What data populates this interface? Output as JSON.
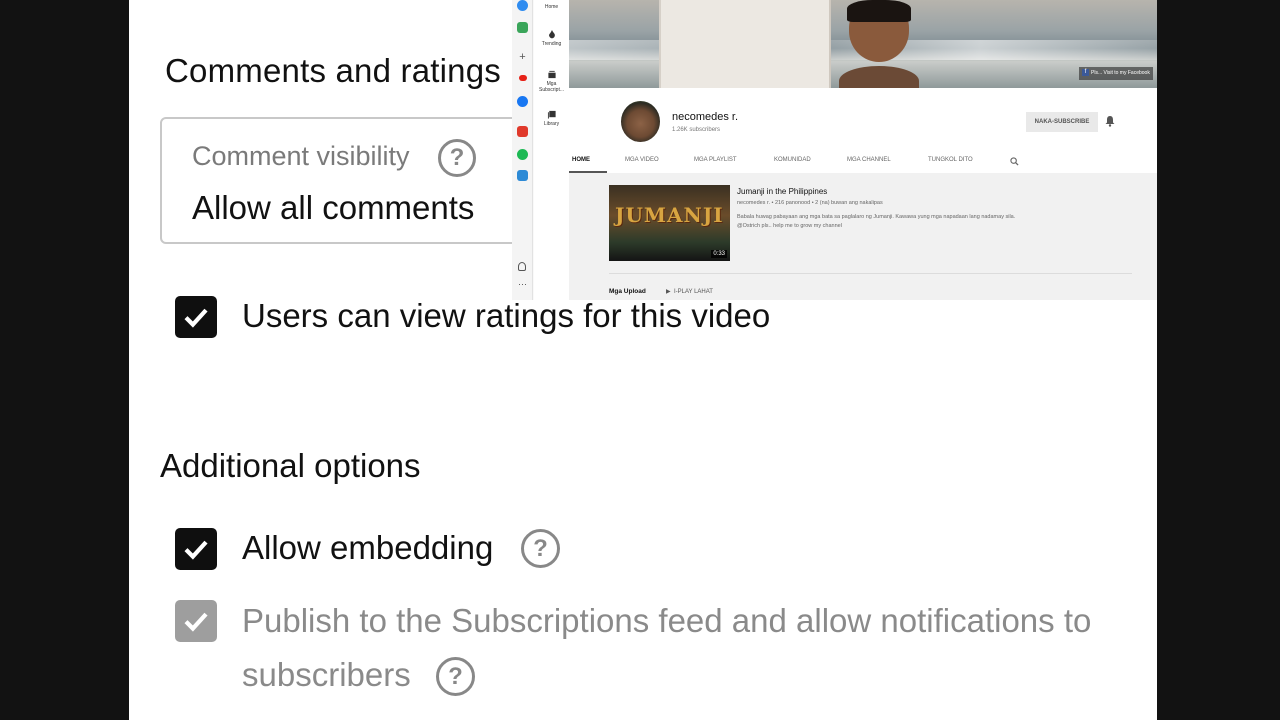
{
  "settings": {
    "comments_title": "Comments and ratings",
    "comment_visibility_label": "Comment visibility",
    "comment_visibility_value": "Allow all comments",
    "ratings_label": "Users can view ratings for this video",
    "additional_title": "Additional options",
    "embedding_label": "Allow embedding",
    "publish_label_line1": "Publish to the Subscriptions feed and allow notifications to",
    "publish_label_line2": "subscribers",
    "help_glyph": "?"
  },
  "youtube": {
    "nav": [
      {
        "label": "Home",
        "icon": "home-icon"
      },
      {
        "label": "Trending",
        "icon": "fire-icon"
      },
      {
        "label": "Mga Subscript...",
        "icon": "subscriptions-icon"
      },
      {
        "label": "Library",
        "icon": "library-icon"
      }
    ],
    "banner_link": "Pls... Visit to my Facebook",
    "channel": {
      "name": "necomedes r.",
      "subscribers": "1.26K subscribers",
      "subscribe_label": "NAKA-SUBSCRIBE"
    },
    "tabs": [
      "HOME",
      "MGA VIDEO",
      "MGA PLAYLIST",
      "KOMUNIDAD",
      "MGA CHANNEL",
      "TUNGKOL DITO"
    ],
    "video": {
      "thumb_text": "JUMANJI",
      "duration": "0:33",
      "title": "Jumanji in the Philippines",
      "meta": "necomedes r. • 216 panonood • 2 (na) buwan ang nakalipas",
      "description": "Babala huwag pabayaan ang mga bata sa paglalaro ng Jumanji. Kawawa yung mga napadaan lang nadamay sila. @Ostrich pls.. help me to grow my channel"
    },
    "uploads_label": "Mga Upload",
    "play_all_label": "I-PLAY LAHAT"
  },
  "colors": {
    "checkbox_checked": "#0f0f0f",
    "checkbox_disabled": "#9e9e9e",
    "text_primary": "#111111",
    "text_muted": "#8a8a8a"
  }
}
